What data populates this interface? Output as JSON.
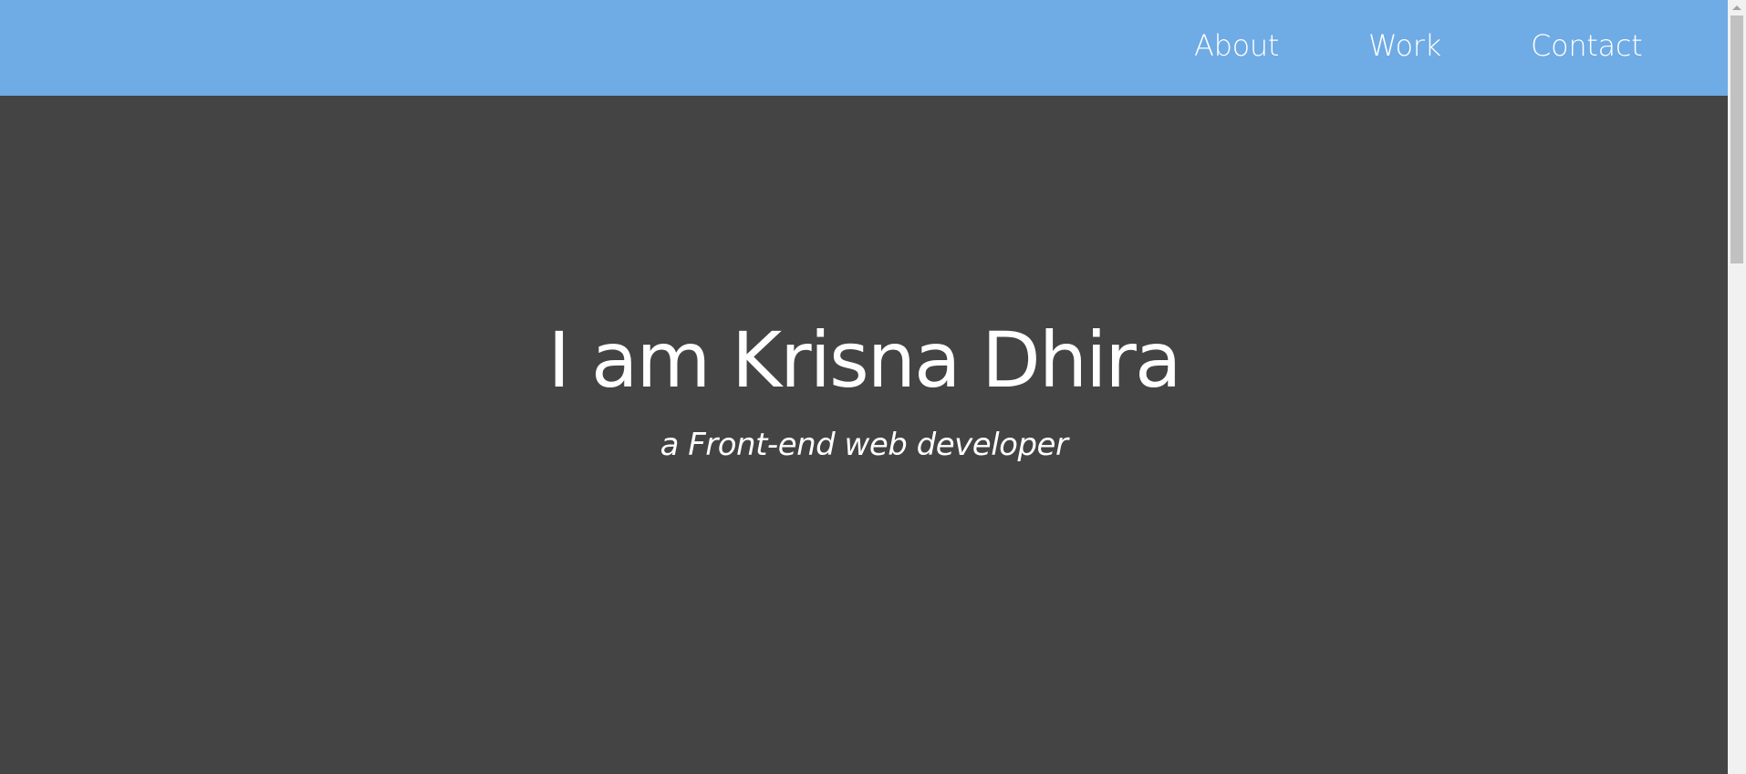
{
  "colors": {
    "navbar": "#6fabe5",
    "hero_background": "#444444",
    "text": "#ffffff",
    "scrollbar_track": "#f1f1f1",
    "scrollbar_thumb": "#c1c1c1"
  },
  "nav": {
    "items": [
      {
        "label": "About"
      },
      {
        "label": "Work"
      },
      {
        "label": "Contact"
      }
    ]
  },
  "hero": {
    "title": "I am Krisna Dhira",
    "subtitle": "a Front-end web developer"
  },
  "scrollbar": {
    "up_icon": "chevron-up-icon"
  }
}
